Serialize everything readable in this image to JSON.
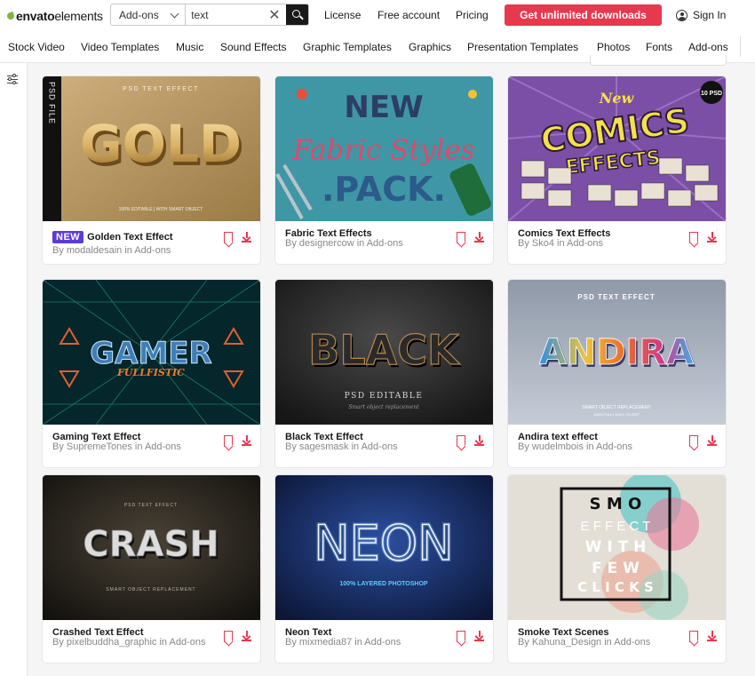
{
  "header": {
    "logo_bold": "envato",
    "logo_light": "elements",
    "search_category": "Add-ons",
    "search_value": "text",
    "links": [
      "License",
      "Free account",
      "Pricing"
    ],
    "cta": "Get unlimited downloads",
    "sign_in": "Sign In"
  },
  "categories": [
    "Stock Video",
    "Video Templates",
    "Music",
    "Sound Effects",
    "Graphic Templates",
    "Graphics",
    "Presentation Templates",
    "Photos",
    "Fonts",
    "Add-ons"
  ],
  "colors": {
    "accent": "#e8384f",
    "badge": "#5c3bd8",
    "logo_leaf": "#82b541"
  },
  "cards": [
    {
      "title": "Golden Text Effect",
      "author": "By modaldesain in Add-ons",
      "badge": "NEW",
      "art": {
        "big": "GOLD",
        "top": "PSD TEXT EFFECT",
        "bottom": "100% EDITABLE | WITH SMART OBJECT",
        "side": "PSD FILE"
      }
    },
    {
      "title": "Fabric Text Effects",
      "author": "By designercow in Add-ons",
      "art": {
        "l1": "NEW",
        "l2": "Fabric Styles",
        "l3": ".PACK."
      }
    },
    {
      "title": "Comics Text Effects",
      "author": "By Sko4 in Add-ons",
      "art": {
        "l1": "New",
        "l2": "COMICS",
        "l3": "EFFECTS",
        "badge": "10 PSD"
      }
    },
    {
      "title": "Gaming Text Effect",
      "author": "By SupremeTones in Add-ons",
      "art": {
        "big": "GAMER",
        "sub": "FULLFISTIC"
      }
    },
    {
      "title": "Black Text Effect",
      "author": "By sagesmask in Add-ons",
      "art": {
        "big": "BLACK",
        "sub": "PSD EDITABLE",
        "sub2": "Smart object replacement"
      }
    },
    {
      "title": "Andira text effect",
      "author": "By wudelmbois in Add-ons",
      "art": {
        "top": "PSD TEXT EFFECT",
        "big": "ANDIRA",
        "sub": "SMART OBJECT REPLACEMENT",
        "sub2": "100% FULLY EASY TO EDIT"
      }
    },
    {
      "title": "Crashed Text Effect",
      "author": "By pixelbuddha_graphic in Add-ons",
      "art": {
        "top": "PSD TEXT EFFECT",
        "big": "CRASH",
        "sub": "SMART OBJECT REPLACEMENT"
      }
    },
    {
      "title": "Neon Text",
      "author": "By mixmedia87 in Add-ons",
      "art": {
        "big": "NEON",
        "sub": "100% LAYERED PHOTOSHOP"
      }
    },
    {
      "title": "Smoke Text Scenes",
      "author": "By Kahuna_Design in Add-ons",
      "art": {
        "rows": [
          "S M O",
          "E F F E C T",
          "W I T H",
          "F E W",
          "C L I C K S"
        ]
      }
    }
  ]
}
